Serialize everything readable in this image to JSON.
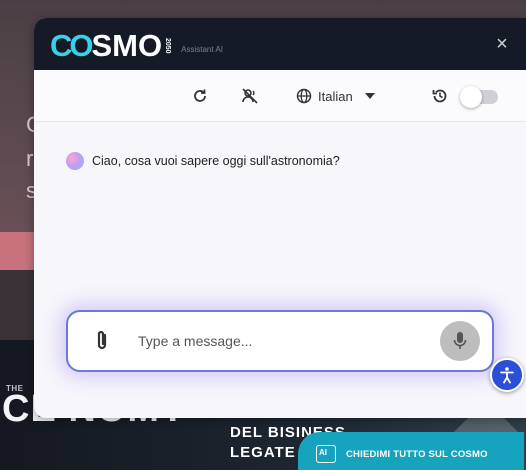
{
  "background": {
    "letters": [
      "C",
      "r",
      "s"
    ],
    "the_label": "THE",
    "headline": "CE NOMY",
    "line1": "DEL BISINESS",
    "line2": "LEGATE"
  },
  "widget": {
    "logo_co": "CO",
    "logo_smo": "SMO",
    "logo_year": "2050",
    "subtitle": "Assistant AI",
    "close_label": "×"
  },
  "toolbar": {
    "refresh_icon": "refresh-icon",
    "voice_off_icon": "voice-off-icon",
    "globe_icon": "globe-icon",
    "language": "Italian",
    "history_icon": "history-icon",
    "toggle_on": false
  },
  "chat": {
    "messages": [
      {
        "sender": "assistant",
        "text": "Ciao, cosa vuoi sapere oggi sull'astronomia?"
      }
    ]
  },
  "composer": {
    "placeholder": "Type a message...",
    "value": "",
    "attach_icon": "paperclip-icon",
    "mic_icon": "microphone-icon"
  },
  "accessibility": {
    "icon": "accessibility-icon"
  },
  "cta": {
    "label": "CHIEDIMI TUTTO SUL COSMO",
    "icon_text": "AI"
  },
  "colors": {
    "accent": "#3ad0e6",
    "titlebar": "#141a26",
    "composer_border": "#6b7ad8",
    "cta": "#16a3bd",
    "access_button": "#2b4fd6"
  }
}
